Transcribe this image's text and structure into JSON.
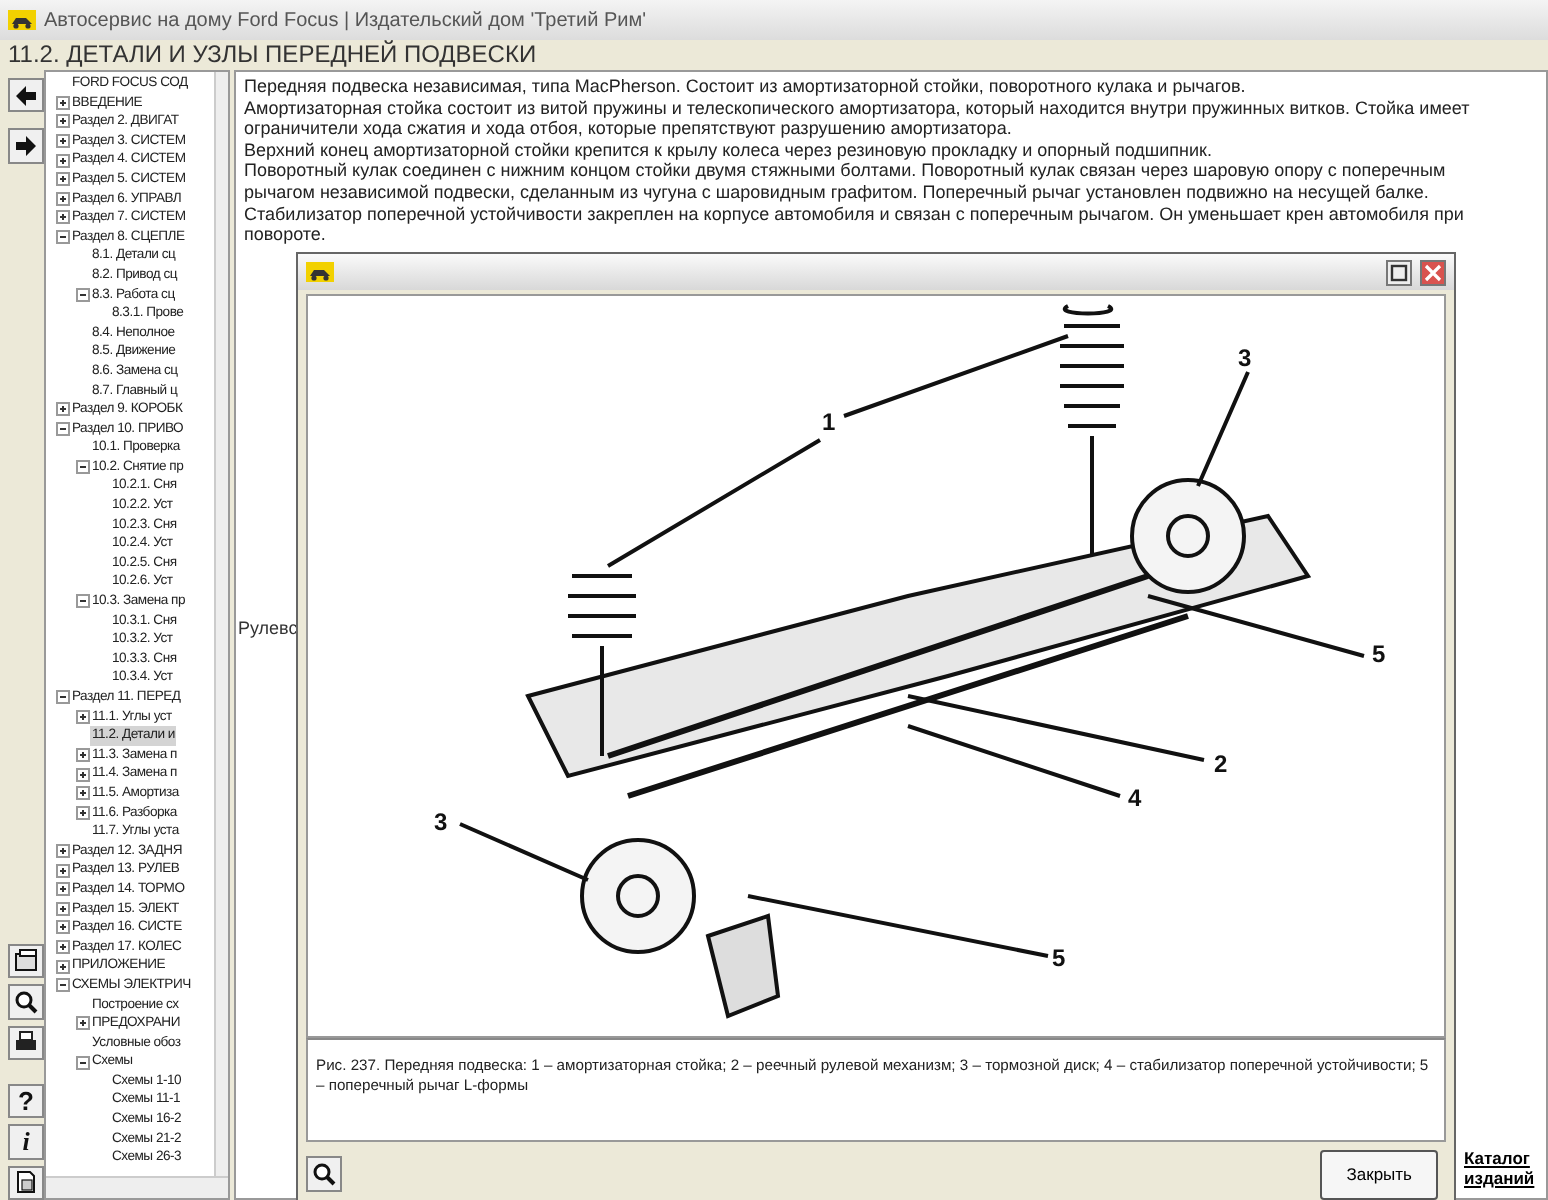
{
  "window": {
    "title": "Автосервис на дому Ford Focus | Издательский дом 'Третий Рим'"
  },
  "heading": "11.2. ДЕТАЛИ И УЗЛЫ ПЕРЕДНЕЙ ПОДВЕСКИ",
  "tree": [
    {
      "label": "FORD FOCUS СОД",
      "selected": false
    },
    {
      "label": "ВВЕДЕНИЕ",
      "expanded": false,
      "selected": false
    },
    {
      "label": "Раздел 2. ДВИГАТ",
      "expanded": false,
      "selected": false
    },
    {
      "label": "Раздел 3. СИСТЕМ",
      "expanded": false,
      "selected": false
    },
    {
      "label": "Раздел 4. СИСТЕМ",
      "expanded": false,
      "selected": false
    },
    {
      "label": "Раздел 5. СИСТЕМ",
      "expanded": false,
      "selected": false
    },
    {
      "label": "Раздел 6. УПРАВЛ",
      "expanded": false,
      "selected": false
    },
    {
      "label": "Раздел 7. СИСТЕМ",
      "expanded": false,
      "selected": false
    },
    {
      "label": "Раздел 8. СЦЕПЛЕ",
      "expanded": true,
      "selected": false,
      "children": [
        {
          "label": "8.1. Детали сц",
          "selected": false
        },
        {
          "label": "8.2. Привод сц",
          "selected": false
        },
        {
          "label": "8.3. Работа сц",
          "expanded": true,
          "selected": false,
          "children": [
            {
              "label": "8.3.1. Прове",
              "selected": false
            }
          ]
        },
        {
          "label": "8.4. Неполное",
          "selected": false
        },
        {
          "label": "8.5. Движение",
          "selected": false
        },
        {
          "label": "8.6. Замена сц",
          "selected": false
        },
        {
          "label": "8.7. Главный ц",
          "selected": false
        }
      ]
    },
    {
      "label": "Раздел 9. КОРОБК",
      "expanded": false,
      "selected": false
    },
    {
      "label": "Раздел 10. ПРИВО",
      "expanded": true,
      "selected": false,
      "children": [
        {
          "label": "10.1. Проверка",
          "selected": false
        },
        {
          "label": "10.2. Снятие пр",
          "expanded": true,
          "selected": false,
          "children": [
            {
              "label": "10.2.1. Сня",
              "selected": false
            },
            {
              "label": "10.2.2. Уст",
              "selected": false
            },
            {
              "label": "10.2.3. Сня",
              "selected": false
            },
            {
              "label": "10.2.4. Уст",
              "selected": false
            },
            {
              "label": "10.2.5. Сня",
              "selected": false
            },
            {
              "label": "10.2.6. Уст",
              "selected": false
            }
          ]
        },
        {
          "label": "10.3. Замена пр",
          "expanded": true,
          "selected": false,
          "children": [
            {
              "label": "10.3.1. Сня",
              "selected": false
            },
            {
              "label": "10.3.2. Уст",
              "selected": false
            },
            {
              "label": "10.3.3. Сня",
              "selected": false
            },
            {
              "label": "10.3.4. Уст",
              "selected": false
            }
          ]
        }
      ]
    },
    {
      "label": "Раздел 11. ПЕРЕД",
      "expanded": true,
      "selected": false,
      "children": [
        {
          "label": "11.1. Углы уст",
          "expanded": false,
          "selected": false
        },
        {
          "label": "11.2. Детали и",
          "selected": true
        },
        {
          "label": "11.3. Замена п",
          "expanded": false,
          "selected": false
        },
        {
          "label": "11.4. Замена п",
          "expanded": false,
          "selected": false
        },
        {
          "label": "11.5. Амортиза",
          "expanded": false,
          "selected": false
        },
        {
          "label": "11.6. Разборка",
          "expanded": false,
          "selected": false
        },
        {
          "label": "11.7. Углы уста",
          "selected": false
        }
      ]
    },
    {
      "label": "Раздел 12. ЗАДНЯ",
      "expanded": false,
      "selected": false
    },
    {
      "label": "Раздел 13. РУЛЕВ",
      "expanded": false,
      "selected": false
    },
    {
      "label": "Раздел 14. ТОРМО",
      "expanded": false,
      "selected": false
    },
    {
      "label": "Раздел 15. ЭЛЕКТ",
      "expanded": false,
      "selected": false
    },
    {
      "label": "Раздел 16. СИСТЕ",
      "expanded": false,
      "selected": false
    },
    {
      "label": "Раздел 17. КОЛЕС",
      "expanded": false,
      "selected": false
    },
    {
      "label": "ПРИЛОЖЕНИЕ",
      "expanded": false,
      "selected": false
    },
    {
      "label": "СХЕМЫ ЭЛЕКТРИЧ",
      "expanded": true,
      "selected": false,
      "children": [
        {
          "label": "Построение сх",
          "selected": false
        },
        {
          "label": "ПРЕДОХРАНИ",
          "expanded": false,
          "selected": false
        },
        {
          "label": "Условные обоз",
          "selected": false
        },
        {
          "label": "Схемы",
          "expanded": true,
          "selected": false,
          "children": [
            {
              "label": "Схемы 1-10",
              "selected": false
            },
            {
              "label": "Схемы 11-1",
              "selected": false
            },
            {
              "label": "Схемы 16-2",
              "selected": false
            },
            {
              "label": "Схемы 21-2",
              "selected": false
            },
            {
              "label": "Схемы 26-3",
              "selected": false
            }
          ]
        }
      ]
    }
  ],
  "article": {
    "paragraphs": [
      "Передняя подвеска независимая, типа MacPherson. Состоит из амортизаторной стойки, поворотного кулака и рычагов.",
      "Амортизаторная стойка состоит из витой пружины и телескопического амортизатора, который находится внутри пружинных витков. Стойка имеет ограничители хода сжатия и хода отбоя, которые препятствуют разрушению амортизатора.",
      "Верхний конец амортизаторной стойки крепится к крылу колеса через резиновую прокладку и опорный подшипник.",
      "Поворотный кулак соединен с нижним концом стойки двумя стяжными болтами. Поворотный кулак связан через шаровую опору с поперечным рычагом независимой подвески, сделанным из чугуна с шаровидным графитом. Поперечный рычаг установлен подвижно на несущей балке.",
      "Стабилизатор поперечной устойчивости закреплен на корпусе автомобиля и связан с поперечным рычагом. Он уменьшает крен автомобиля при повороте."
    ],
    "partial_text": "Рулевс"
  },
  "figure_window": {
    "callouts": [
      "3",
      "1",
      "5",
      "2",
      "4",
      "3",
      "5"
    ],
    "caption": "Рис. 237. Передняя подвеска: 1 – амортизаторная стойка; 2 – реечный рулевой механизм; 3 – тормозной диск; 4 – стабилизатор поперечной устойчивости; 5 – поперечный рычаг L-формы",
    "close_button": "Закрыть"
  },
  "catalog_link": "Каталог изданий",
  "help_button": "?",
  "info_button": "i"
}
